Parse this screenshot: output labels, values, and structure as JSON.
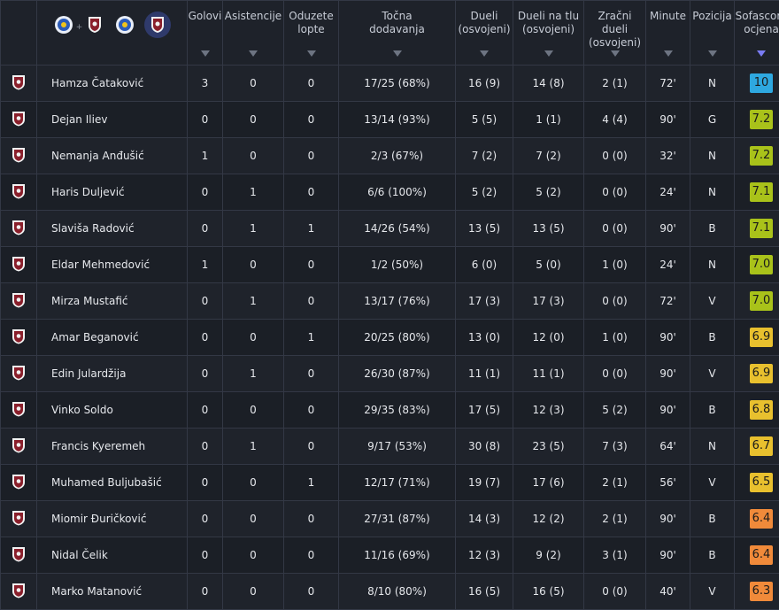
{
  "columns": [
    {
      "key": "golovi",
      "label": "Golovi"
    },
    {
      "key": "asistencije",
      "label": "Asistencije"
    },
    {
      "key": "oduzete",
      "label": "Oduzete lopte"
    },
    {
      "key": "dodavanja",
      "label": "Točna dodavanja"
    },
    {
      "key": "dueli",
      "label": "Dueli (osvojeni)"
    },
    {
      "key": "dueli_tlo",
      "label": "Dueli na tlu (osvojeni)"
    },
    {
      "key": "zracni",
      "label": "Zračni dueli (osvojeni)"
    },
    {
      "key": "minute",
      "label": "Minute"
    },
    {
      "key": "pozicija",
      "label": "Pozicija"
    },
    {
      "key": "ocjena",
      "label": "Sofascore ocjena"
    }
  ],
  "header_labels": {
    "golovi": [
      "Golovi"
    ],
    "asistencije": [
      "Asistencije"
    ],
    "oduzete": [
      "Oduzete",
      "lopte"
    ],
    "dodavanja": [
      "Točna",
      "dodavanja"
    ],
    "dueli": [
      "Dueli",
      "(osvojeni)"
    ],
    "dueli_tlo": [
      "Dueli na tlu",
      "(osvojeni)"
    ],
    "zracni": [
      "Zračni dueli",
      "(osvojeni)"
    ],
    "minute": [
      "Minute"
    ],
    "pozicija": [
      "Pozicija"
    ],
    "ocjena": [
      "Sofascore",
      "ocjena"
    ]
  },
  "team_filter": {
    "plus": "+"
  },
  "colors": {
    "accent": "#7a7cf3",
    "r10": "#2ea8e0",
    "r7": "#a9c21a",
    "r6": "#e8c02e",
    "r6low": "#f08a3a",
    "team_blue": "#2c5cb8",
    "team_maroon": "#8a1f2b"
  },
  "players": [
    {
      "name": "Hamza Čataković",
      "golovi": "3",
      "asistencije": "0",
      "oduzete": "0",
      "dodavanja": "17/25 (68%)",
      "dueli": "16 (9)",
      "dueli_tlo": "14 (8)",
      "zracni": "2 (1)",
      "minute": "72'",
      "pozicija": "N",
      "ocjena": "10"
    },
    {
      "name": "Dejan Iliev",
      "golovi": "0",
      "asistencije": "0",
      "oduzete": "0",
      "dodavanja": "13/14 (93%)",
      "dueli": "5 (5)",
      "dueli_tlo": "1 (1)",
      "zracni": "4 (4)",
      "minute": "90'",
      "pozicija": "G",
      "ocjena": "7.2"
    },
    {
      "name": "Nemanja Anđušić",
      "golovi": "1",
      "asistencije": "0",
      "oduzete": "0",
      "dodavanja": "2/3 (67%)",
      "dueli": "7 (2)",
      "dueli_tlo": "7 (2)",
      "zracni": "0 (0)",
      "minute": "32'",
      "pozicija": "N",
      "ocjena": "7.2"
    },
    {
      "name": "Haris Duljević",
      "golovi": "0",
      "asistencije": "1",
      "oduzete": "0",
      "dodavanja": "6/6 (100%)",
      "dueli": "5 (2)",
      "dueli_tlo": "5 (2)",
      "zracni": "0 (0)",
      "minute": "24'",
      "pozicija": "N",
      "ocjena": "7.1"
    },
    {
      "name": "Slaviša Radović",
      "golovi": "0",
      "asistencije": "1",
      "oduzete": "1",
      "dodavanja": "14/26 (54%)",
      "dueli": "13 (5)",
      "dueli_tlo": "13 (5)",
      "zracni": "0 (0)",
      "minute": "90'",
      "pozicija": "B",
      "ocjena": "7.1"
    },
    {
      "name": "Eldar Mehmedović",
      "golovi": "1",
      "asistencije": "0",
      "oduzete": "0",
      "dodavanja": "1/2 (50%)",
      "dueli": "6 (0)",
      "dueli_tlo": "5 (0)",
      "zracni": "1 (0)",
      "minute": "24'",
      "pozicija": "N",
      "ocjena": "7.0"
    },
    {
      "name": "Mirza Mustafić",
      "golovi": "0",
      "asistencije": "1",
      "oduzete": "0",
      "dodavanja": "13/17 (76%)",
      "dueli": "17 (3)",
      "dueli_tlo": "17 (3)",
      "zracni": "0 (0)",
      "minute": "72'",
      "pozicija": "V",
      "ocjena": "7.0"
    },
    {
      "name": "Amar Beganović",
      "golovi": "0",
      "asistencije": "0",
      "oduzete": "1",
      "dodavanja": "20/25 (80%)",
      "dueli": "13 (0)",
      "dueli_tlo": "12 (0)",
      "zracni": "1 (0)",
      "minute": "90'",
      "pozicija": "B",
      "ocjena": "6.9"
    },
    {
      "name": "Edin Julardžija",
      "golovi": "0",
      "asistencije": "1",
      "oduzete": "0",
      "dodavanja": "26/30 (87%)",
      "dueli": "11 (1)",
      "dueli_tlo": "11 (1)",
      "zracni": "0 (0)",
      "minute": "90'",
      "pozicija": "V",
      "ocjena": "6.9"
    },
    {
      "name": "Vinko Soldo",
      "golovi": "0",
      "asistencije": "0",
      "oduzete": "0",
      "dodavanja": "29/35 (83%)",
      "dueli": "17 (5)",
      "dueli_tlo": "12 (3)",
      "zracni": "5 (2)",
      "minute": "90'",
      "pozicija": "B",
      "ocjena": "6.8"
    },
    {
      "name": "Francis Kyeremeh",
      "golovi": "0",
      "asistencije": "1",
      "oduzete": "0",
      "dodavanja": "9/17 (53%)",
      "dueli": "30 (8)",
      "dueli_tlo": "23 (5)",
      "zracni": "7 (3)",
      "minute": "64'",
      "pozicija": "N",
      "ocjena": "6.7"
    },
    {
      "name": "Muhamed Buljubašić",
      "golovi": "0",
      "asistencije": "0",
      "oduzete": "1",
      "dodavanja": "12/17 (71%)",
      "dueli": "19 (7)",
      "dueli_tlo": "17 (6)",
      "zracni": "2 (1)",
      "minute": "56'",
      "pozicija": "V",
      "ocjena": "6.5"
    },
    {
      "name": "Miomir Đuričković",
      "golovi": "0",
      "asistencije": "0",
      "oduzete": "0",
      "dodavanja": "27/31 (87%)",
      "dueli": "14 (3)",
      "dueli_tlo": "12 (2)",
      "zracni": "2 (1)",
      "minute": "90'",
      "pozicija": "B",
      "ocjena": "6.4"
    },
    {
      "name": "Nidal Čelik",
      "golovi": "0",
      "asistencije": "0",
      "oduzete": "0",
      "dodavanja": "11/16 (69%)",
      "dueli": "12 (3)",
      "dueli_tlo": "9 (2)",
      "zracni": "3 (1)",
      "minute": "90'",
      "pozicija": "B",
      "ocjena": "6.4"
    },
    {
      "name": "Marko Matanović",
      "golovi": "0",
      "asistencije": "0",
      "oduzete": "0",
      "dodavanja": "8/10 (80%)",
      "dueli": "16 (5)",
      "dueli_tlo": "16 (5)",
      "zracni": "0 (0)",
      "minute": "40'",
      "pozicija": "V",
      "ocjena": "6.3"
    }
  ]
}
